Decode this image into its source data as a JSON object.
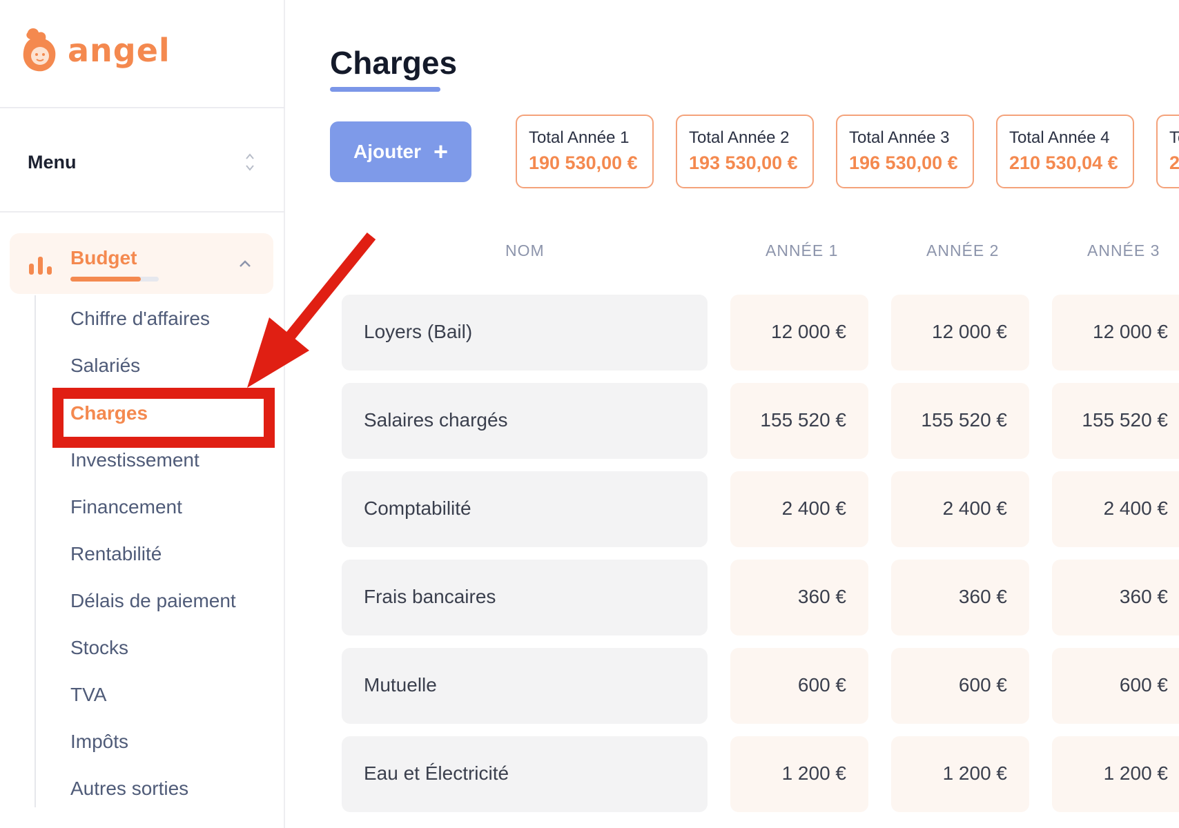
{
  "app": {
    "logo_text": "angel"
  },
  "sidebar": {
    "menu_label": "Menu",
    "section": {
      "label": "Budget",
      "progress": 0.8
    },
    "items": [
      {
        "label": "Chiffre d'affaires",
        "active": false
      },
      {
        "label": "Salariés",
        "active": false
      },
      {
        "label": "Charges",
        "active": true
      },
      {
        "label": "Investissement",
        "active": false
      },
      {
        "label": "Financement",
        "active": false
      },
      {
        "label": "Rentabilité",
        "active": false
      },
      {
        "label": "Délais de paiement",
        "active": false
      },
      {
        "label": "Stocks",
        "active": false
      },
      {
        "label": "TVA",
        "active": false
      },
      {
        "label": "Impôts",
        "active": false
      },
      {
        "label": "Autres sorties",
        "active": false
      }
    ]
  },
  "main": {
    "title": "Charges",
    "add_button": {
      "label": "Ajouter",
      "icon": "plus-icon"
    },
    "totals": [
      {
        "label": "Total Année 1",
        "value": "190 530,00 €"
      },
      {
        "label": "Total Année 2",
        "value": "193 530,00 €"
      },
      {
        "label": "Total Année 3",
        "value": "196 530,00 €"
      },
      {
        "label": "Total Année 4",
        "value": "210 530,04 €"
      },
      {
        "label": "To",
        "value": "2"
      }
    ],
    "columns": [
      "NOM",
      "ANNÉE 1",
      "ANNÉE 2",
      "ANNÉE 3"
    ],
    "rows": [
      {
        "name": "Loyers (Bail)",
        "y1": "12 000 €",
        "y2": "12 000 €",
        "y3": "12 000 €"
      },
      {
        "name": "Salaires chargés",
        "y1": "155 520 €",
        "y2": "155 520 €",
        "y3": "155 520 €"
      },
      {
        "name": "Comptabilité",
        "y1": "2 400 €",
        "y2": "2 400 €",
        "y3": "2 400 €"
      },
      {
        "name": "Frais bancaires",
        "y1": "360 €",
        "y2": "360 €",
        "y3": "360 €"
      },
      {
        "name": "Mutuelle",
        "y1": "600 €",
        "y2": "600 €",
        "y3": "600 €"
      },
      {
        "name": "Eau et Électricité",
        "y1": "1 200 €",
        "y2": "1 200 €",
        "y3": "1 200 €"
      }
    ]
  },
  "colors": {
    "accent_orange": "#f4894f",
    "accent_blue": "#7e9ae9",
    "annotation_red": "#e01f13"
  }
}
